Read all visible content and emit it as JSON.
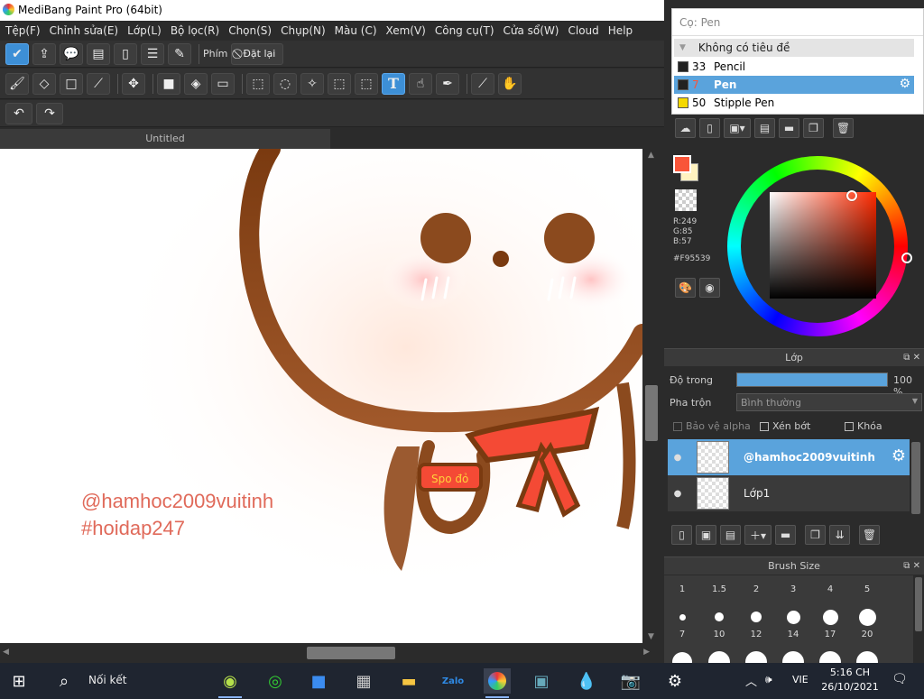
{
  "window": {
    "title": "MediBang Paint Pro (64bit)",
    "restore_glyph": "❐",
    "close_glyph": "✕"
  },
  "menu": [
    "Tệp(F)",
    "Chỉnh sửa(E)",
    "Lớp(L)",
    "Bộ lọc(R)",
    "Chọn(S)",
    "Chụp(N)",
    "Màu (C)",
    "Xem(V)",
    "Công cụ(T)",
    "Cửa sổ(W)",
    "Cloud",
    "Help"
  ],
  "toolbar1": {
    "shortcut_label": "Phím",
    "reset_label": "Đặt lại",
    "icons": [
      "check-icon",
      "share-icon",
      "comment-icon",
      "chat-icon",
      "page-icon",
      "list-icon",
      "edit-icon"
    ]
  },
  "toolbar2": {
    "icons": [
      "brush-icon",
      "eraser-icon",
      "rectangle-icon",
      "line-icon",
      "move-icon",
      "fill-rect-icon",
      "bucket-icon",
      "gradient-icon",
      "select-rect-icon",
      "lasso-icon",
      "magic-wand-icon",
      "select-pen-icon",
      "select-eraser-icon",
      "text-icon",
      "operation-icon",
      "pen-icon",
      "eyedropper-icon",
      "hand-icon"
    ],
    "text_tool_glyph": "T"
  },
  "toolbar3": {
    "undo_glyph": "↶",
    "redo_glyph": "↷"
  },
  "canvas": {
    "tab_label": "Untitled",
    "watermark_line1": "@hamhoc2009vuitinh",
    "watermark_line2": "#hoidap247",
    "scarf_text": "Spo đỏ"
  },
  "brush_panel": {
    "title": "Cọ: Pen",
    "group": "Không có tiêu đề",
    "items": [
      {
        "size": "33",
        "name": "Pencil",
        "color": "#222222"
      },
      {
        "size": "7",
        "name": "Pen",
        "color": "#222222"
      },
      {
        "size": "50",
        "name": "Stipple Pen",
        "color": "#f5d800"
      }
    ],
    "selected_index": 1
  },
  "color_panel": {
    "r": "R:249",
    "g": "G:85",
    "b": "B:57",
    "hex": "#F95539",
    "primary_color": "#f95539",
    "secondary_color": "#fff2c0"
  },
  "layer_panel": {
    "title": "Lớp",
    "opacity_label": "Độ trong",
    "opacity_value": "100 %",
    "opacity": 1.0,
    "blend_label": "Pha trộn",
    "blend_value": "Bình thường",
    "protect_alpha": "Bảo vệ alpha",
    "clipping": "Xén bớt",
    "lock": "Khóa",
    "layers": [
      {
        "name": "@hamhoc2009vuitinh",
        "selected": true
      },
      {
        "name": "Lớp1",
        "selected": false
      }
    ]
  },
  "brush_size_panel": {
    "title": "Brush Size",
    "sizes_row1": [
      "1",
      "1.5",
      "2",
      "3",
      "4",
      "5"
    ],
    "sizes_row2": [
      "7",
      "10",
      "12",
      "14",
      "17",
      "20"
    ]
  },
  "taskbar": {
    "search_label": "Nối kết",
    "language": "VIE",
    "time": "5:16 CH",
    "date": "26/10/2021"
  }
}
